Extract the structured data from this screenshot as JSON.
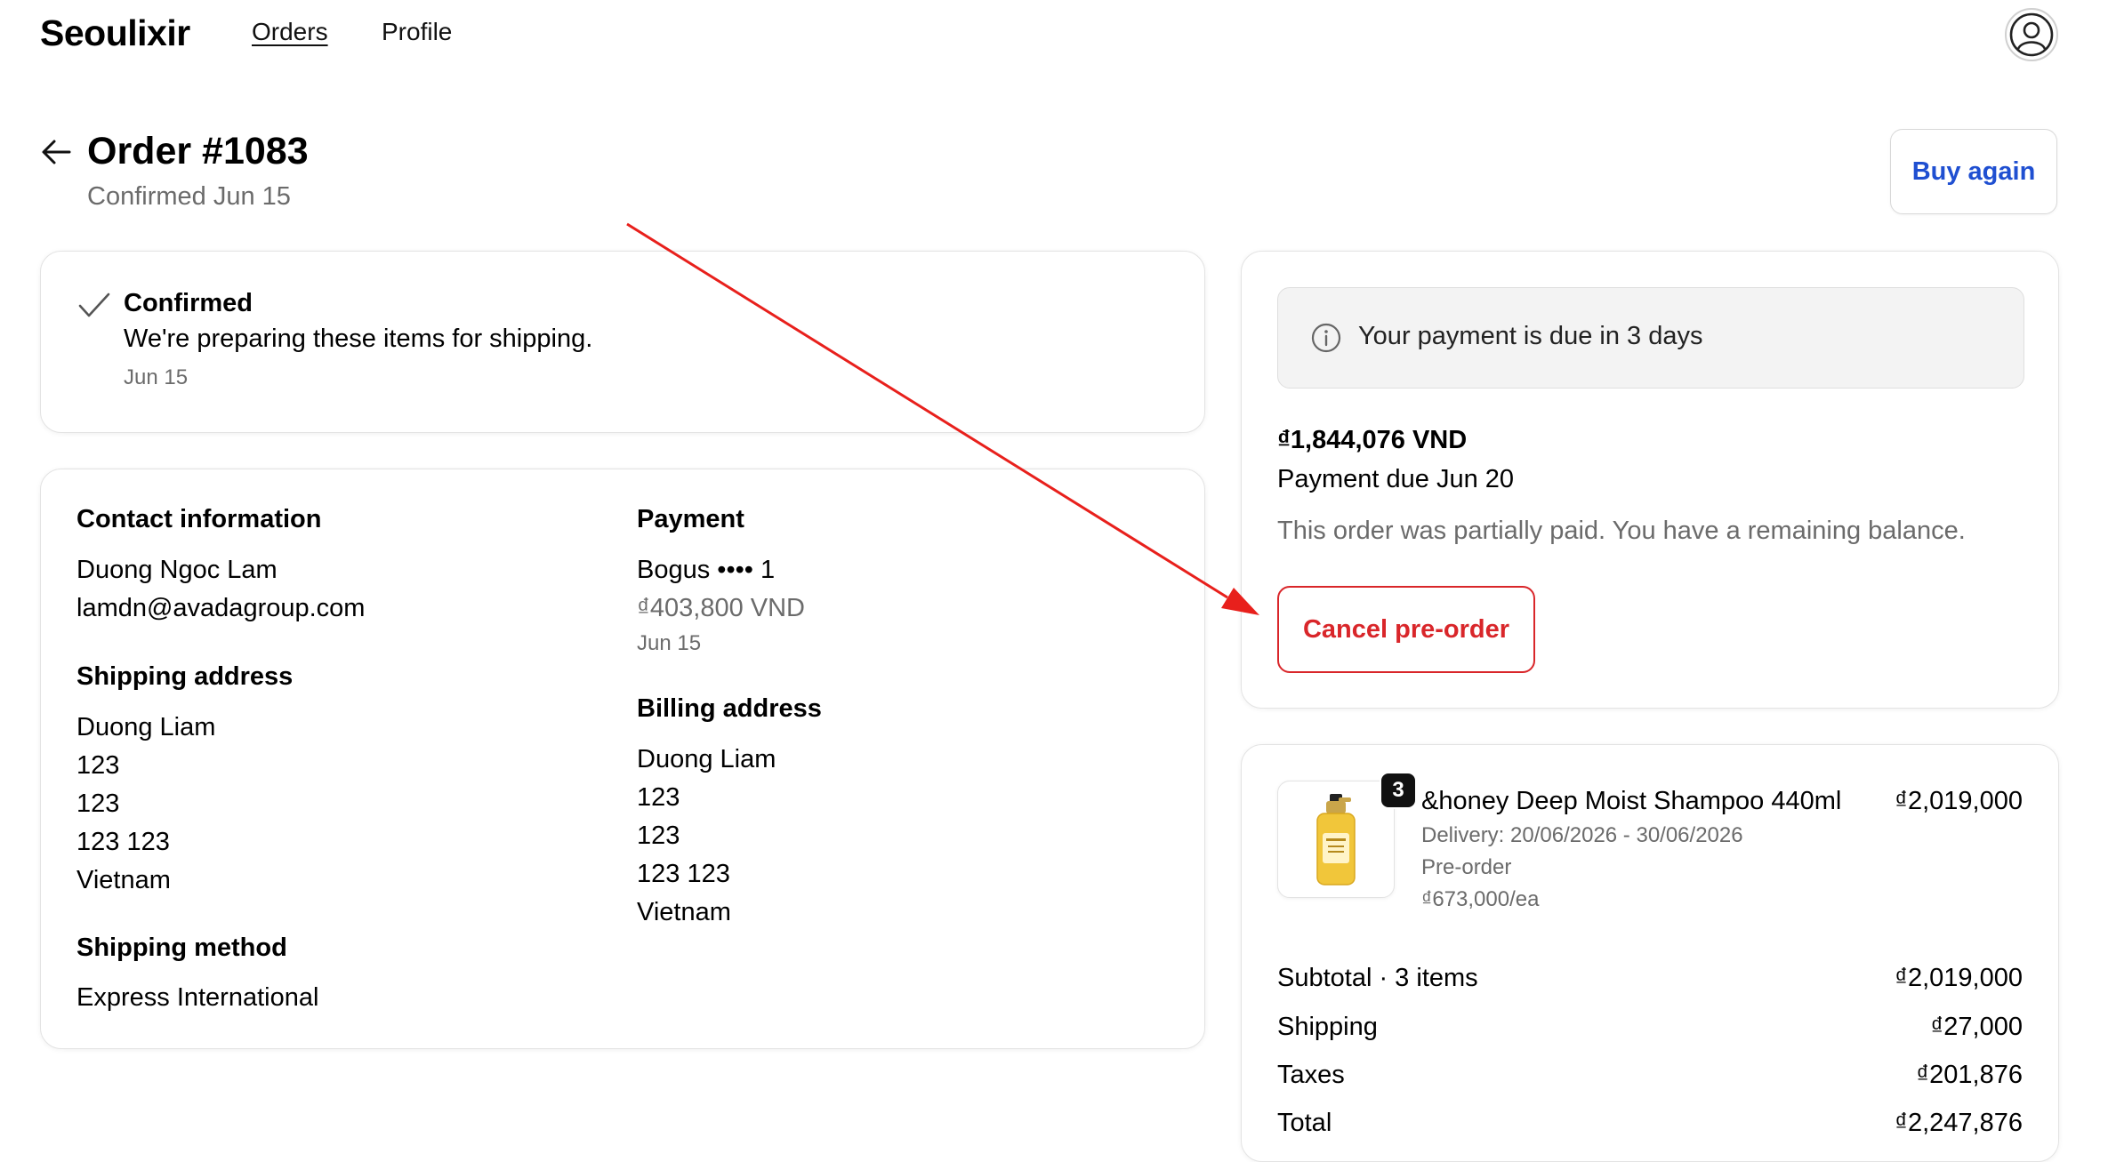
{
  "header": {
    "brand": "Seoulixir",
    "nav": [
      "Orders",
      "Profile"
    ],
    "account_icon": "user-circle-icon"
  },
  "order": {
    "back_icon": "arrow-left-icon",
    "title": "Order #1083",
    "subtitle": "Confirmed Jun 15",
    "buy_again_label": "Buy again"
  },
  "status": {
    "icon": "checkmark-icon",
    "title": "Confirmed",
    "message": "We're preparing these items for shipping.",
    "date": "Jun 15"
  },
  "details": {
    "contact": {
      "heading": "Contact information",
      "name": "Duong Ngoc Lam",
      "email": "lamdn@avadagroup.com"
    },
    "shipping_address": {
      "heading": "Shipping address",
      "lines": [
        "Duong Liam",
        "123",
        "123",
        "123 123",
        "Vietnam"
      ]
    },
    "shipping_method": {
      "heading": "Shipping method",
      "value": "Express International"
    },
    "payment": {
      "heading": "Payment",
      "method": "Bogus •••• 1",
      "amount": "₫403,800 VND",
      "date": "Jun 15"
    },
    "billing_address": {
      "heading": "Billing address",
      "lines": [
        "Duong Liam",
        "123",
        "123",
        "123 123",
        "Vietnam"
      ]
    }
  },
  "payment_due": {
    "notice_icon": "info-icon",
    "notice": "Your payment is due in 3 days",
    "amount": "₫1,844,076 VND",
    "due": "Payment due Jun 20",
    "note": "This order was partially paid. You have a remaining balance.",
    "cancel_label": "Cancel pre-order"
  },
  "line_item": {
    "quantity": "3",
    "name": "&honey Deep Moist Shampoo 440ml",
    "price": "₫2,019,000",
    "delivery": "Delivery: 20/06/2026 - 30/06/2026",
    "tag": "Pre-order",
    "unit_price": "₫673,000/ea"
  },
  "summary": {
    "subtotal_label": "Subtotal · 3 items",
    "subtotal": "₫2,019,000",
    "shipping_label": "Shipping",
    "shipping": "₫27,000",
    "taxes_label": "Taxes",
    "taxes": "₫201,876",
    "total_label": "Total",
    "total": "₫2,247,876"
  },
  "colors": {
    "accent_blue": "#1f4fd1",
    "danger_red": "#d9262a",
    "annotation_arrow": "#e8201c"
  }
}
